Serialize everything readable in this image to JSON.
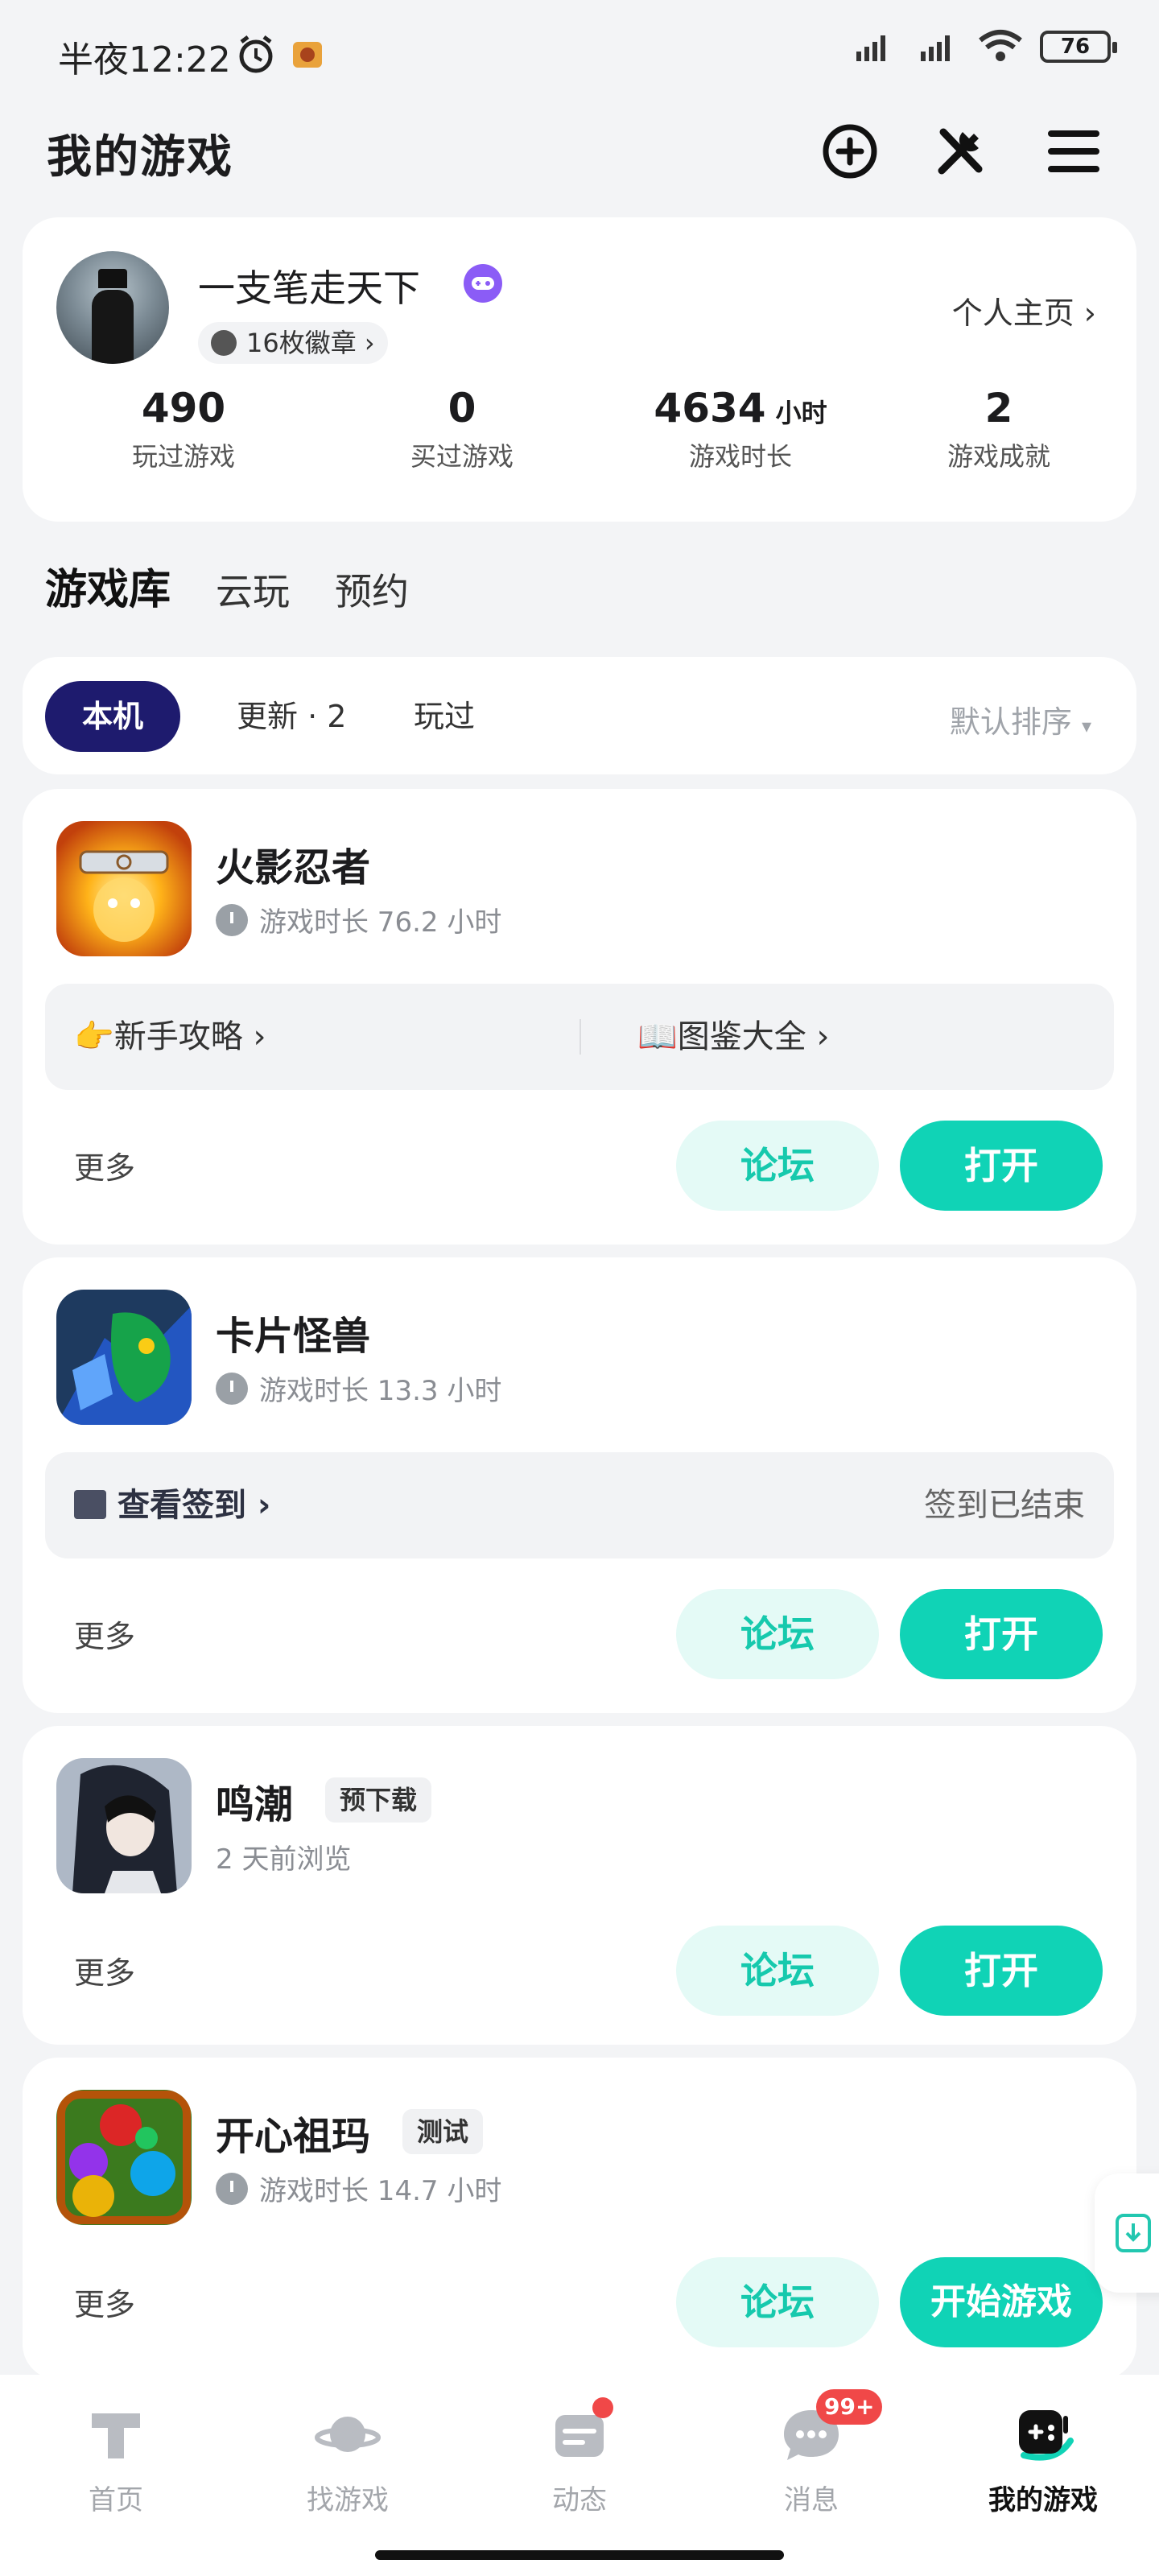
{
  "status_bar": {
    "time": "半夜12:22",
    "battery": "76"
  },
  "header": {
    "title": "我的游戏"
  },
  "profile": {
    "username": "一支笔走天下",
    "medals": "16枚徽章",
    "homepage_link": "个人主页",
    "stats": [
      {
        "value": "490",
        "unit": "",
        "label": "玩过游戏"
      },
      {
        "value": "0",
        "unit": "",
        "label": "买过游戏"
      },
      {
        "value": "4634",
        "unit": "小时",
        "label": "游戏时长"
      },
      {
        "value": "2",
        "unit": "",
        "label": "游戏成就"
      }
    ]
  },
  "library_tabs": [
    "游戏库",
    "云玩",
    "预约"
  ],
  "filter": {
    "pills": [
      "本机",
      "更新 · 2",
      "玩过"
    ],
    "sort": "默认排序"
  },
  "games": [
    {
      "name": "火影忍者",
      "tag": "",
      "meta": "游戏时长 76.2 小时",
      "links": [
        "👉新手攻略",
        "📖图鉴大全"
      ],
      "more": "更多",
      "forum": "论坛",
      "open": "打开"
    },
    {
      "name": "卡片怪兽",
      "tag": "",
      "meta": "游戏时长 13.3 小时",
      "checkin": "查看签到",
      "checkin_status": "签到已结束",
      "more": "更多",
      "forum": "论坛",
      "open": "打开"
    },
    {
      "name": "鸣潮",
      "tag": "预下载",
      "meta": "2 天前浏览",
      "more": "更多",
      "forum": "论坛",
      "open": "打开"
    },
    {
      "name": "开心祖玛",
      "tag": "测试",
      "meta": "游戏时长 14.7 小时",
      "more": "更多",
      "forum": "论坛",
      "open": "开始游戏"
    }
  ],
  "bottom_nav": [
    {
      "label": "首页",
      "icon": "home-icon"
    },
    {
      "label": "找游戏",
      "icon": "planet-icon"
    },
    {
      "label": "动态",
      "icon": "feed-icon"
    },
    {
      "label": "消息",
      "icon": "message-icon",
      "badge": "99+"
    },
    {
      "label": "我的游戏",
      "icon": "gamepad-icon"
    }
  ],
  "colors": {
    "accent": "#10d3b6",
    "active_filter": "#1e1b6e",
    "badge": "#f04848"
  }
}
